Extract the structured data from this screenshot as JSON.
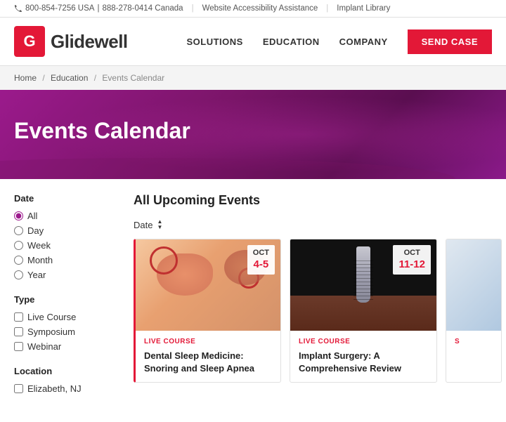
{
  "topbar": {
    "phone_usa": "800-854-7256 USA",
    "phone_canada": "888-278-0414 Canada",
    "separator": "|",
    "links": [
      "Website Accessibility Assistance",
      "Implant Library"
    ],
    "phone_icon": "📞"
  },
  "header": {
    "logo_letter": "G",
    "logo_text": "Glidewell",
    "nav_items": [
      "SOLUTIONS",
      "EDUCATION",
      "COMPANY"
    ],
    "cta_label": "SEND CASE"
  },
  "breadcrumb": {
    "items": [
      "Home",
      "Education",
      "Events Calendar"
    ]
  },
  "hero": {
    "title": "Events Calendar"
  },
  "sidebar": {
    "date_section": {
      "title": "Date",
      "options": [
        "All",
        "Day",
        "Week",
        "Month",
        "Year"
      ],
      "selected": "All"
    },
    "type_section": {
      "title": "Type",
      "options": [
        "Live Course",
        "Symposium",
        "Webinar"
      ]
    },
    "location_section": {
      "title": "Location",
      "options": [
        "Elizabeth, NJ"
      ]
    }
  },
  "events": {
    "section_title": "All Upcoming Events",
    "sort_label": "Date",
    "cards": [
      {
        "type": "LIVE COURSE",
        "title": "Dental Sleep Medicine: Snoring and Sleep Apnea",
        "date_month": "OCT",
        "date_day": "4-5"
      },
      {
        "type": "LIVE COURSE",
        "title": "Implant Surgery: A Comprehensive Review",
        "date_month": "OCT",
        "date_day": "11-12"
      },
      {
        "type": "S",
        "title": "",
        "date_month": "",
        "date_day": ""
      }
    ]
  }
}
